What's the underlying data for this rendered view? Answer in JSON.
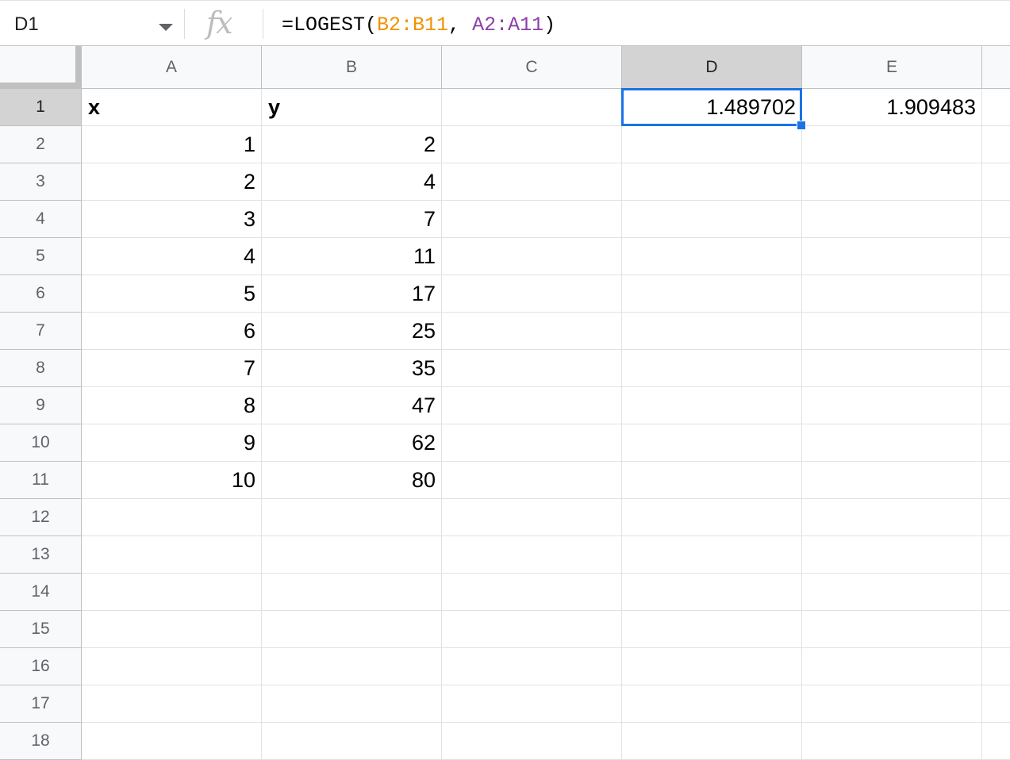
{
  "formula_bar": {
    "name_box": "D1",
    "fx_label": "fx",
    "formula_prefix": "=LOGEST(",
    "formula_ref1": "B2:B11",
    "formula_sep": ", ",
    "formula_ref2": "A2:A11",
    "formula_suffix": ")"
  },
  "columns": [
    "A",
    "B",
    "C",
    "D",
    "E"
  ],
  "selected_column": "D",
  "rows": [
    "1",
    "2",
    "3",
    "4",
    "5",
    "6",
    "7",
    "8",
    "9",
    "10",
    "11",
    "12",
    "13",
    "14",
    "15",
    "16",
    "17",
    "18"
  ],
  "selected_row": "1",
  "cells": {
    "A1": "x",
    "B1": "y",
    "D1": "1.489702",
    "E1": "1.909483",
    "A2": "1",
    "B2": "2",
    "A3": "2",
    "B3": "4",
    "A4": "3",
    "B4": "7",
    "A5": "4",
    "B5": "11",
    "A6": "5",
    "B6": "17",
    "A7": "6",
    "B7": "25",
    "A8": "7",
    "B8": "35",
    "A9": "8",
    "B9": "47",
    "A10": "9",
    "B10": "62",
    "A11": "10",
    "B11": "80"
  },
  "colors": {
    "selection": "#1a73e8",
    "ref1": "#f09300",
    "ref2": "#8e3fa8"
  }
}
